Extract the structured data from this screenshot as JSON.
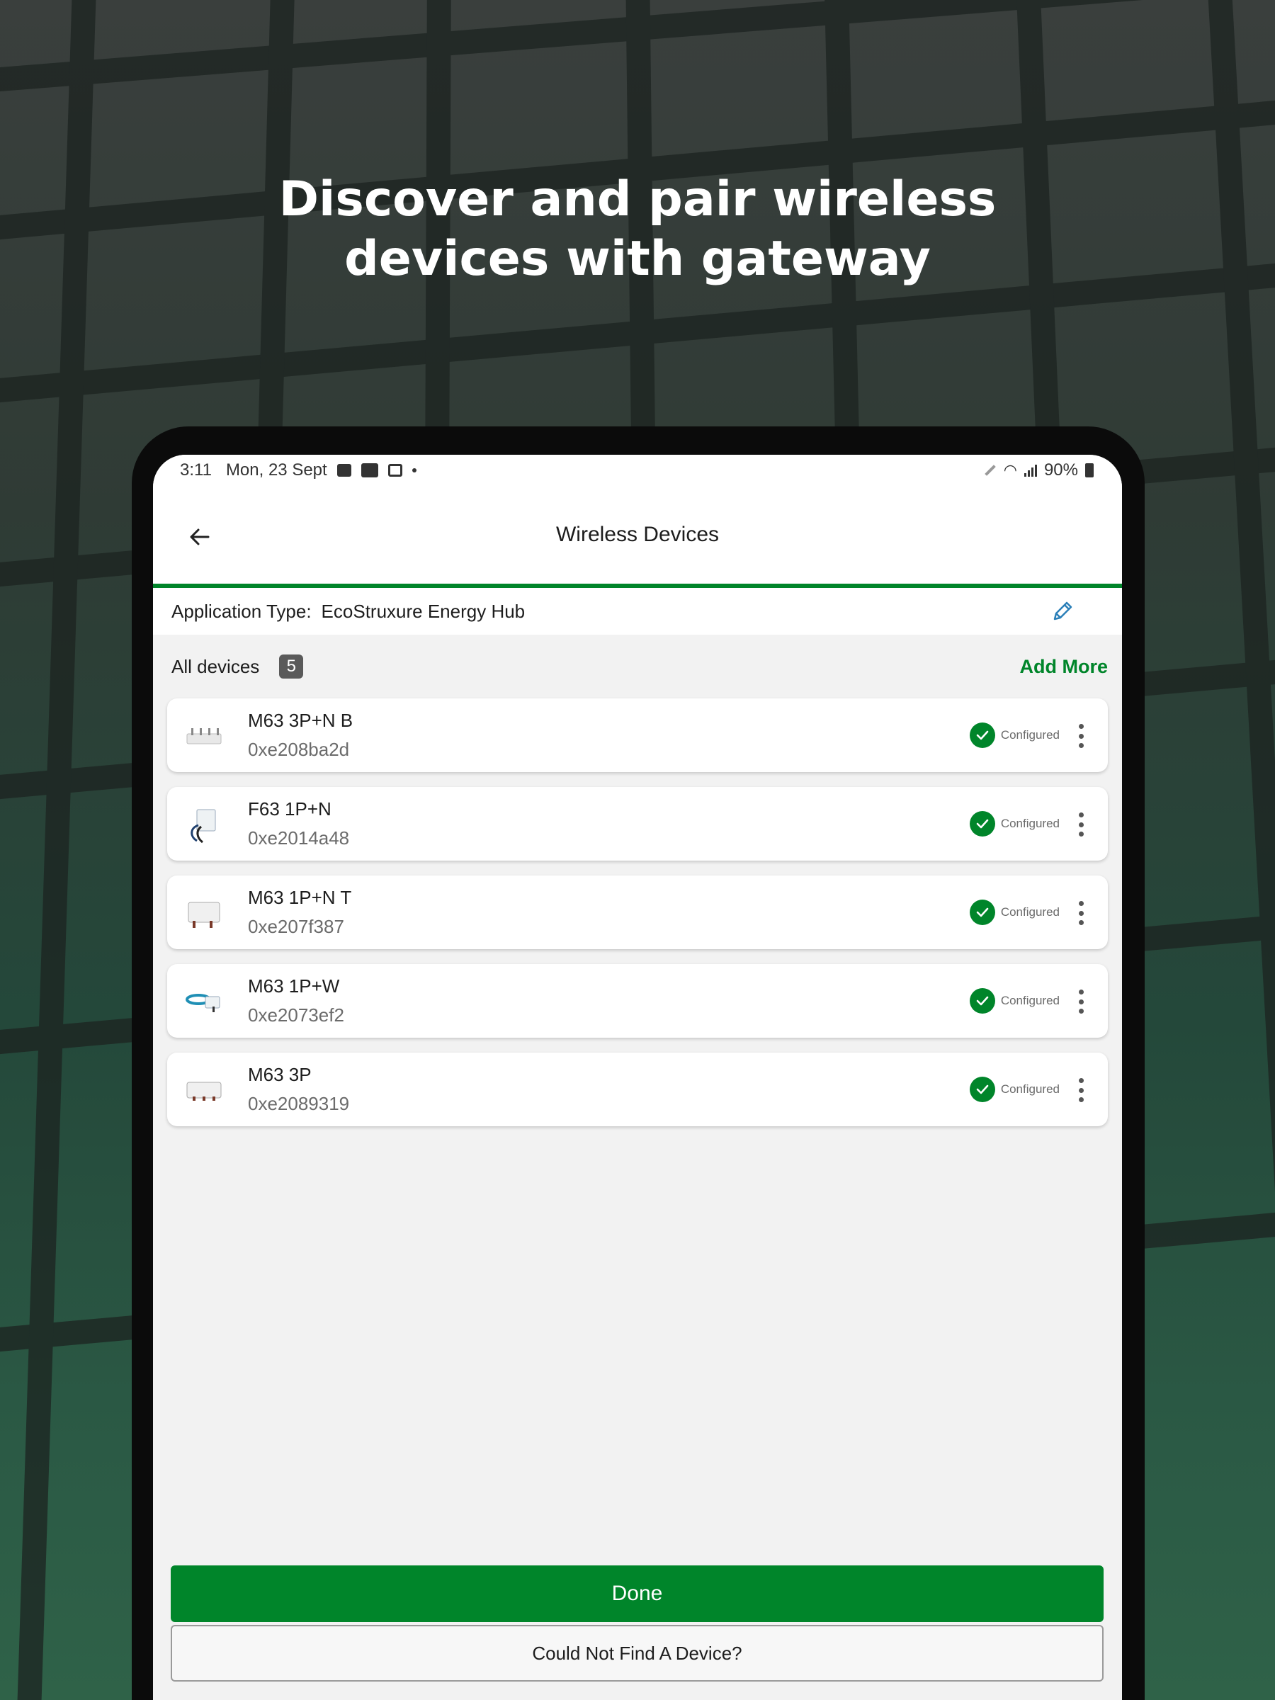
{
  "headline": {
    "line1": "Discover and pair wireless",
    "line2": "devices with gateway"
  },
  "status_bar": {
    "time": "3:11",
    "date": "Mon, 23 Sept",
    "battery": "90%"
  },
  "app_bar": {
    "title": "Wireless Devices"
  },
  "application_type": {
    "label": "Application Type:",
    "value": "EcoStruxure Energy Hub"
  },
  "devices_header": {
    "label": "All devices",
    "count": "5",
    "add_more": "Add More"
  },
  "devices": [
    {
      "name": "M63 3P+N B",
      "address": "0xe208ba2d",
      "status": "Configured"
    },
    {
      "name": "F63 1P+N",
      "address": "0xe2014a48",
      "status": "Configured"
    },
    {
      "name": "M63 1P+N T",
      "address": "0xe207f387",
      "status": "Configured"
    },
    {
      "name": "M63 1P+W",
      "address": "0xe2073ef2",
      "status": "Configured"
    },
    {
      "name": "M63 3P",
      "address": "0xe2089319",
      "status": "Configured"
    }
  ],
  "buttons": {
    "done": "Done",
    "not_found": "Could Not Find A Device?"
  },
  "colors": {
    "accent": "#00852a",
    "badge": "#5a5a5a"
  }
}
